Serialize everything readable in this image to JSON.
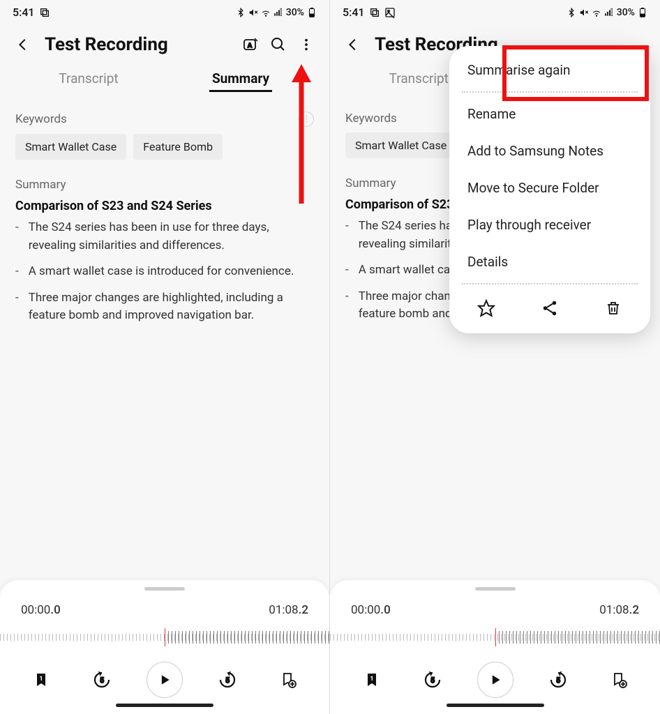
{
  "status": {
    "time": "5:41",
    "battery_pct": "30%"
  },
  "header": {
    "title": "Test Recording"
  },
  "tabs": {
    "transcript": "Transcript",
    "summary": "Summary"
  },
  "sections": {
    "keywords_label": "Keywords",
    "summary_label": "Summary"
  },
  "keywords": [
    "Smart Wallet Case",
    "Feature Bomb"
  ],
  "summary": {
    "heading": "Comparison of S23 and S24 Series",
    "points": [
      "The S24 series has been in use for three days, revealing similarities and differences.",
      "A smart wallet case is introduced for convenience.",
      "Three major changes are highlighted, including a feature bomb and improved navigation bar."
    ]
  },
  "player": {
    "current": "00:00",
    "current_frac": ".0",
    "total": "01:08",
    "total_frac": ".2",
    "bookmark_count": "1"
  },
  "menu": {
    "items": [
      "Summarise again",
      "Rename",
      "Add to Samsung Notes",
      "Move to Secure Folder",
      "Play through receiver",
      "Details"
    ]
  }
}
